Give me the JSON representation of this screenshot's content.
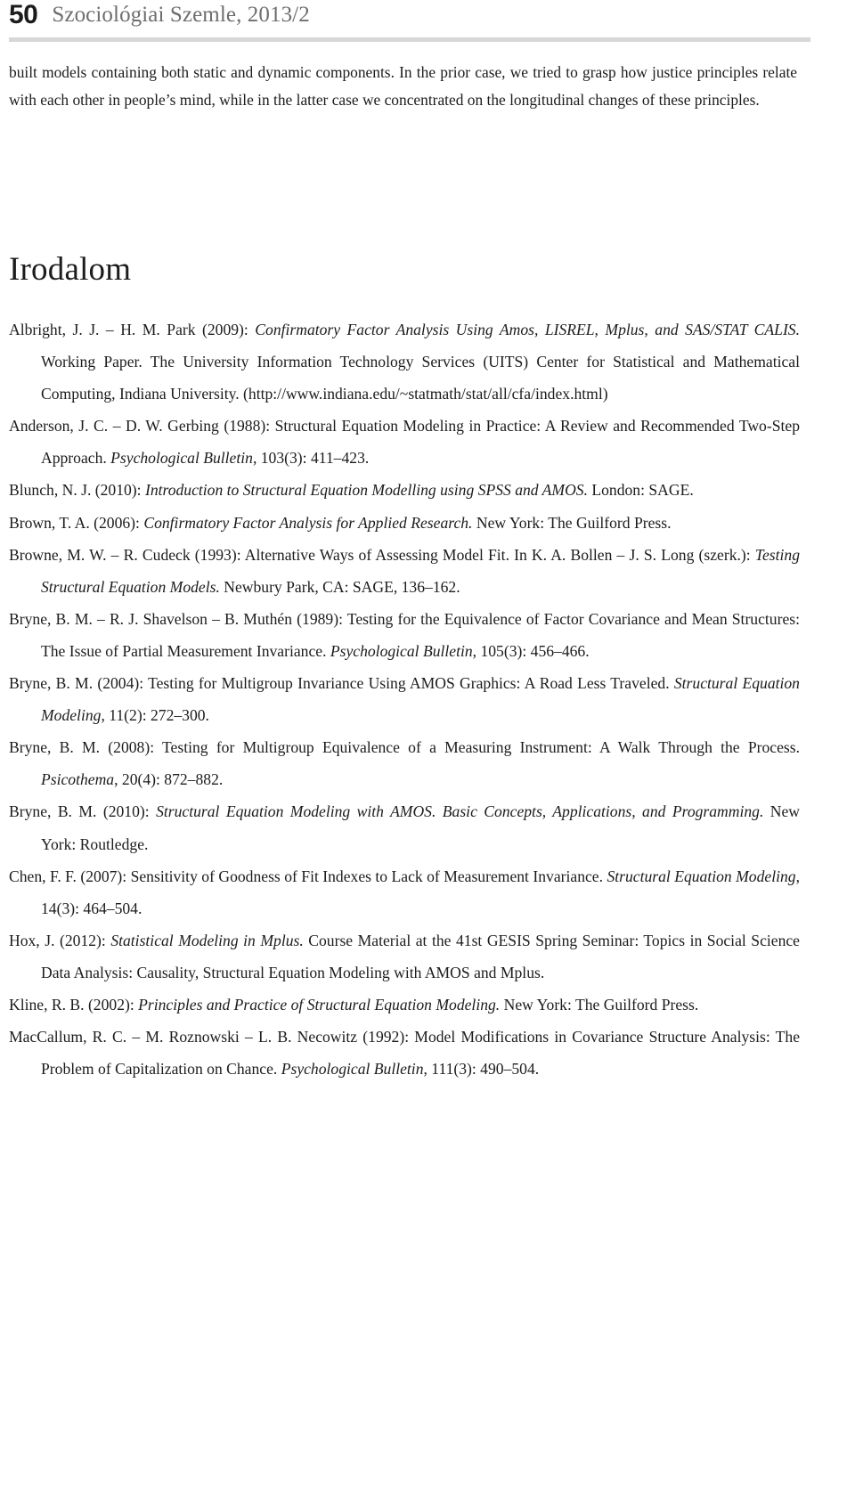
{
  "header": {
    "folio": "50",
    "running_title": "Szociológiai Szemle, 2013/2"
  },
  "intro_paragraph": "built models containing both static and dynamic components. In the prior case, we tried to grasp how justice principles relate with each other in people’s mind, while in the latter case we concentrated on the longitudinal changes of these principles.",
  "section": {
    "heading": "Irodalom"
  },
  "references": [
    {
      "id": "albright-park-2009",
      "parts": [
        {
          "text": "Albright, J. J. – H. M. Park (2009): ",
          "italic": false
        },
        {
          "text": "Confirmatory Factor Analysis Using Amos, LISREL, Mplus, and SAS/STAT CALIS.",
          "italic": true
        },
        {
          "text": " Working Paper. The University Information Technology Services (UITS) Center for Statistical and Mathematical Computing, Indiana University. (http://www.indiana.edu/~statmath/stat/all/cfa/index.html)",
          "italic": false
        }
      ]
    },
    {
      "id": "anderson-gerbing-1988",
      "parts": [
        {
          "text": "Anderson, J. C. – D. W. Gerbing (1988): Structural Equation Modeling in Practice: A Review and Recommended Two-Step Approach. ",
          "italic": false
        },
        {
          "text": "Psychological Bulletin",
          "italic": true
        },
        {
          "text": ", 103(3): 411–423.",
          "italic": false
        }
      ]
    },
    {
      "id": "blunch-2010",
      "parts": [
        {
          "text": "Blunch, N. J. (2010): ",
          "italic": false
        },
        {
          "text": "Introduction to Structural Equation Modelling using SPSS and AMOS.",
          "italic": true
        },
        {
          "text": " London: SAGE.",
          "italic": false
        }
      ]
    },
    {
      "id": "brown-2006",
      "parts": [
        {
          "text": "Brown, T. A. (2006): ",
          "italic": false
        },
        {
          "text": "Confirmatory Factor Analysis for Applied Research.",
          "italic": true
        },
        {
          "text": " New York: The Guilford Press.",
          "italic": false
        }
      ]
    },
    {
      "id": "browne-cudeck-1993",
      "parts": [
        {
          "text": "Browne, M. W. – R. Cudeck (1993): Alternative Ways of Assessing Model Fit. In K. A. Bollen – J. S. Long (szerk.): ",
          "italic": false
        },
        {
          "text": "Testing Structural Equation Models.",
          "italic": true
        },
        {
          "text": " Newbury Park, CA: SAGE, 136–162.",
          "italic": false
        }
      ]
    },
    {
      "id": "bryne-shavelson-muthen-1989",
      "parts": [
        {
          "text": "Bryne, B. M. – R. J. Shavelson – B. Muthén (1989): Testing for the Equivalence of Factor Covariance and Mean Structures: The Issue of Partial Measurement Invariance. ",
          "italic": false
        },
        {
          "text": "Psychological Bulletin",
          "italic": true
        },
        {
          "text": ", 105(3): 456–466.",
          "italic": false
        }
      ]
    },
    {
      "id": "bryne-2004",
      "parts": [
        {
          "text": "Bryne, B. M. (2004): Testing for Multigroup Invariance Using AMOS Graphics: A Road Less Traveled. ",
          "italic": false
        },
        {
          "text": "Structural Equation Modeling",
          "italic": true
        },
        {
          "text": ", 11(2): 272–300.",
          "italic": false
        }
      ]
    },
    {
      "id": "bryne-2008",
      "parts": [
        {
          "text": "Bryne, B. M. (2008): Testing for Multigroup Equivalence of a Measuring Instrument: A Walk Through the Process. ",
          "italic": false
        },
        {
          "text": "Psicothema",
          "italic": true
        },
        {
          "text": ", 20(4): 872–882.",
          "italic": false
        }
      ]
    },
    {
      "id": "bryne-2010",
      "parts": [
        {
          "text": "Bryne, B. M. (2010): ",
          "italic": false
        },
        {
          "text": "Structural Equation Modeling with AMOS. Basic Concepts, Applications, and Programming.",
          "italic": true
        },
        {
          "text": " New York: Routledge.",
          "italic": false
        }
      ]
    },
    {
      "id": "chen-2007",
      "parts": [
        {
          "text": "Chen, F. F. (2007): Sensitivity of Goodness of Fit Indexes to Lack of Measurement Invariance. ",
          "italic": false
        },
        {
          "text": "Structural Equation Modeling",
          "italic": true
        },
        {
          "text": ", 14(3): 464–504.",
          "italic": false
        }
      ]
    },
    {
      "id": "hox-2012",
      "parts": [
        {
          "text": "Hox, J. (2012): ",
          "italic": false
        },
        {
          "text": "Statistical Modeling in Mplus.",
          "italic": true
        },
        {
          "text": " Course Material at the 41st GESIS Spring Seminar: Topics in Social Science Data Analysis: Causality, Structural Equation Modeling with AMOS and Mplus.",
          "italic": false
        }
      ]
    },
    {
      "id": "kline-2002",
      "parts": [
        {
          "text": "Kline, R. B. (2002): ",
          "italic": false
        },
        {
          "text": "Principles and Practice of Structural Equation Modeling.",
          "italic": true
        },
        {
          "text": " New York: The Guilford Press.",
          "italic": false
        }
      ]
    },
    {
      "id": "maccallum-roznowski-necowitz-1992",
      "parts": [
        {
          "text": "MacCallum, R. C. – M. Roznowski  – L. B. Necowitz (1992): Model Modifications in Covariance Structure Analysis: The Problem of Capitalization on Chance. ",
          "italic": false
        },
        {
          "text": "Psychological Bulletin",
          "italic": true
        },
        {
          "text": ", 111(3): 490–504.",
          "italic": false
        }
      ]
    }
  ],
  "colors": {
    "text": "#1c1c1c",
    "running_title": "#6e6e6e",
    "rule": "#d7d7d7",
    "page_background": "#ffffff"
  }
}
